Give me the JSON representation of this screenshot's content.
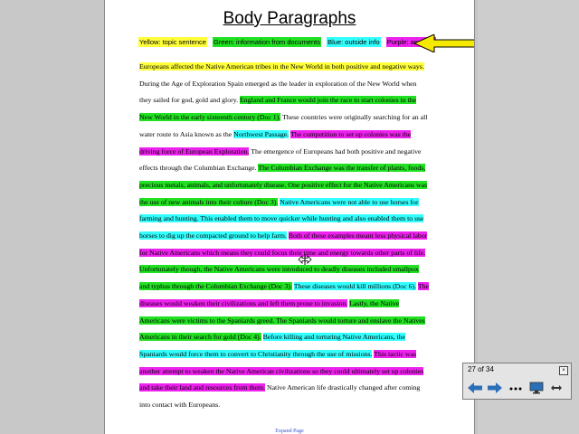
{
  "document": {
    "title": "Body Paragraphs",
    "legend": [
      {
        "label": "Yellow: topic sentence",
        "color": "#ffff3a"
      },
      {
        "label": "Green: information from documents",
        "color": "#22e022"
      },
      {
        "label": "Blue: outside info",
        "color": "#33ffff"
      },
      {
        "label": "Purple: analysis",
        "color": "#ee22ee"
      }
    ],
    "segments": [
      {
        "hl": "y",
        "text": "Europeans affected the Native American tribes in the New World in both positive and negative ways."
      },
      {
        "hl": "",
        "text": " During the Age of Exploration Spain emerged as the leader in exploration of the New World when they sailed for god, gold and glory.  "
      },
      {
        "hl": "g",
        "text": "England and France would join the race to start colonies in the New World in the early sixteenth century (Doc 1)."
      },
      {
        "hl": "",
        "text": " These countries were originally searching  for an all water route to Asia known as the "
      },
      {
        "hl": "b",
        "text": "Northwest Passage."
      },
      {
        "hl": "",
        "text": " "
      },
      {
        "hl": "p",
        "text": "The competition to set up colonies was the driving force of European Exploration."
      },
      {
        "hl": "",
        "text": " The emergence of Europeans had both positive and negative effects through the Columbian Exchange. "
      },
      {
        "hl": "g",
        "text": "The Columbian Exchange was the transfer of plants, foods, precious metals, animals, and unfortunately disease. One positive effect for the Native Americans was the use of new animals into their culture (Doc 3)."
      },
      {
        "hl": "",
        "text": " "
      },
      {
        "hl": "b",
        "text": "Native Americans were not able to use horses for farming and hunting. This enabled them to move quicker while hunting and also enabled them to use horses to dig up the compacted ground to help farm."
      },
      {
        "hl": "",
        "text": " "
      },
      {
        "hl": "p",
        "text": "Both of these examples meant less physical labor for Native Americans which means they could focus their time and energy towards other parts of life."
      },
      {
        "hl": "",
        "text": " "
      },
      {
        "hl": "g",
        "text": "Unfortunately though, the Native Americans were introduced to deadly diseases included smallpox and typhus through the Columbian Exchange (Doc 3)."
      },
      {
        "hl": "",
        "text": " "
      },
      {
        "hl": "b",
        "text": "These diseases would kill millions (Doc 6)."
      },
      {
        "hl": "",
        "text": " "
      },
      {
        "hl": "p",
        "text": "The diseases would weaken their civilizations and left them prone to invasion."
      },
      {
        "hl": "",
        "text": " "
      },
      {
        "hl": "g",
        "text": "Lastly, the Native Americans were victims to the Spaniards greed. The Spaniards would torture and enslave the Natives Americans in their search for gold (Doc 4)."
      },
      {
        "hl": "",
        "text": " "
      },
      {
        "hl": "b",
        "text": "Before killing and torturing Native Americans, the Spaniards would force them to convert to Christianity through the use of missions."
      },
      {
        "hl": "",
        "text": " "
      },
      {
        "hl": "p",
        "text": "This tactic was another attempt to weaken the Native American civilizations so they could ultimately set up colonies and take their land and resources from them."
      },
      {
        "hl": "",
        "text": "  Native American life drastically changed after coming into contact with Europeans."
      }
    ],
    "footer_link": "Expand Page"
  },
  "navigator": {
    "counter": "27 of 34",
    "close_glyph": "×",
    "buttons": [
      "previous-slide",
      "next-slide",
      "more-options",
      "screen-view",
      "expand"
    ]
  },
  "colors": {
    "arrow": "#f5e900",
    "nav_arrow": "#2a6fb8"
  }
}
